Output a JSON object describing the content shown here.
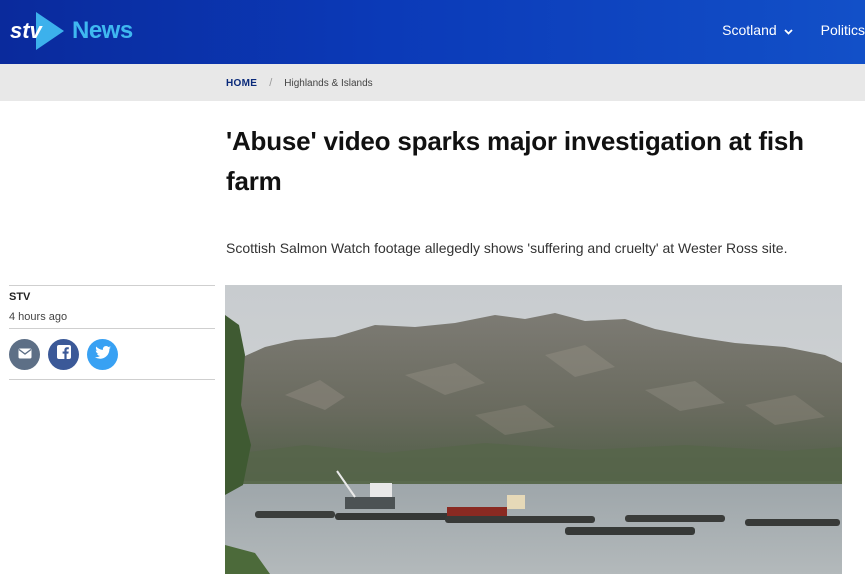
{
  "header": {
    "logo_icon": "stv-logo-icon",
    "logo_text": "News",
    "nav": [
      {
        "label": "Scotland",
        "icon": "chevron-down-icon"
      },
      {
        "label": "Politics"
      }
    ]
  },
  "breadcrumb": {
    "home": "HOME",
    "separator": "/",
    "current": "Highlands & Islands"
  },
  "article": {
    "headline": "'Abuse' video sparks major investigation at fish farm",
    "standfirst": "Scottish Salmon Watch footage allegedly shows 'suffering and cruelty' at Wester Ross site.",
    "author": "STV",
    "time": "4 hours ago",
    "share": [
      {
        "icon": "email-icon",
        "color": "#5d6f86"
      },
      {
        "icon": "facebook-icon",
        "color": "#3b5998"
      },
      {
        "icon": "twitter-icon",
        "color": "#38a1f3"
      }
    ],
    "image": "fish-farm-loch-photo"
  },
  "colors": {
    "header_start": "#0a2a9c",
    "header_end": "#1250c8",
    "logo_accent": "#3fb8f0",
    "breadcrumb_bg": "#e8e8e8"
  }
}
